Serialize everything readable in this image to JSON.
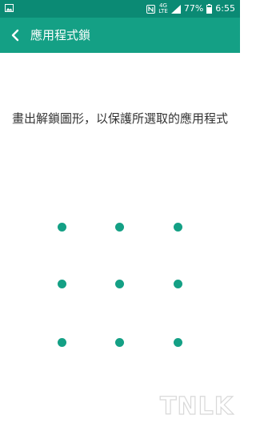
{
  "status_bar": {
    "network_top": "4G",
    "network_bottom": "LTE",
    "battery_percent": "77%",
    "time": "6:55",
    "icons": [
      "gallery-icon",
      "nfc-icon",
      "signal-icon",
      "battery-icon"
    ]
  },
  "app_bar": {
    "title": "應用程式鎖",
    "back_icon": "back-arrow-icon"
  },
  "main": {
    "instruction": "畫出解鎖圖形，以保護所選取的應用程式"
  },
  "pattern": {
    "rows": 3,
    "cols": 3
  },
  "watermark": {
    "text": "TNLK"
  },
  "colors": {
    "accent": "#14a085",
    "status_bar": "#0b8a74",
    "text": "#333333",
    "background": "#ffffff"
  }
}
